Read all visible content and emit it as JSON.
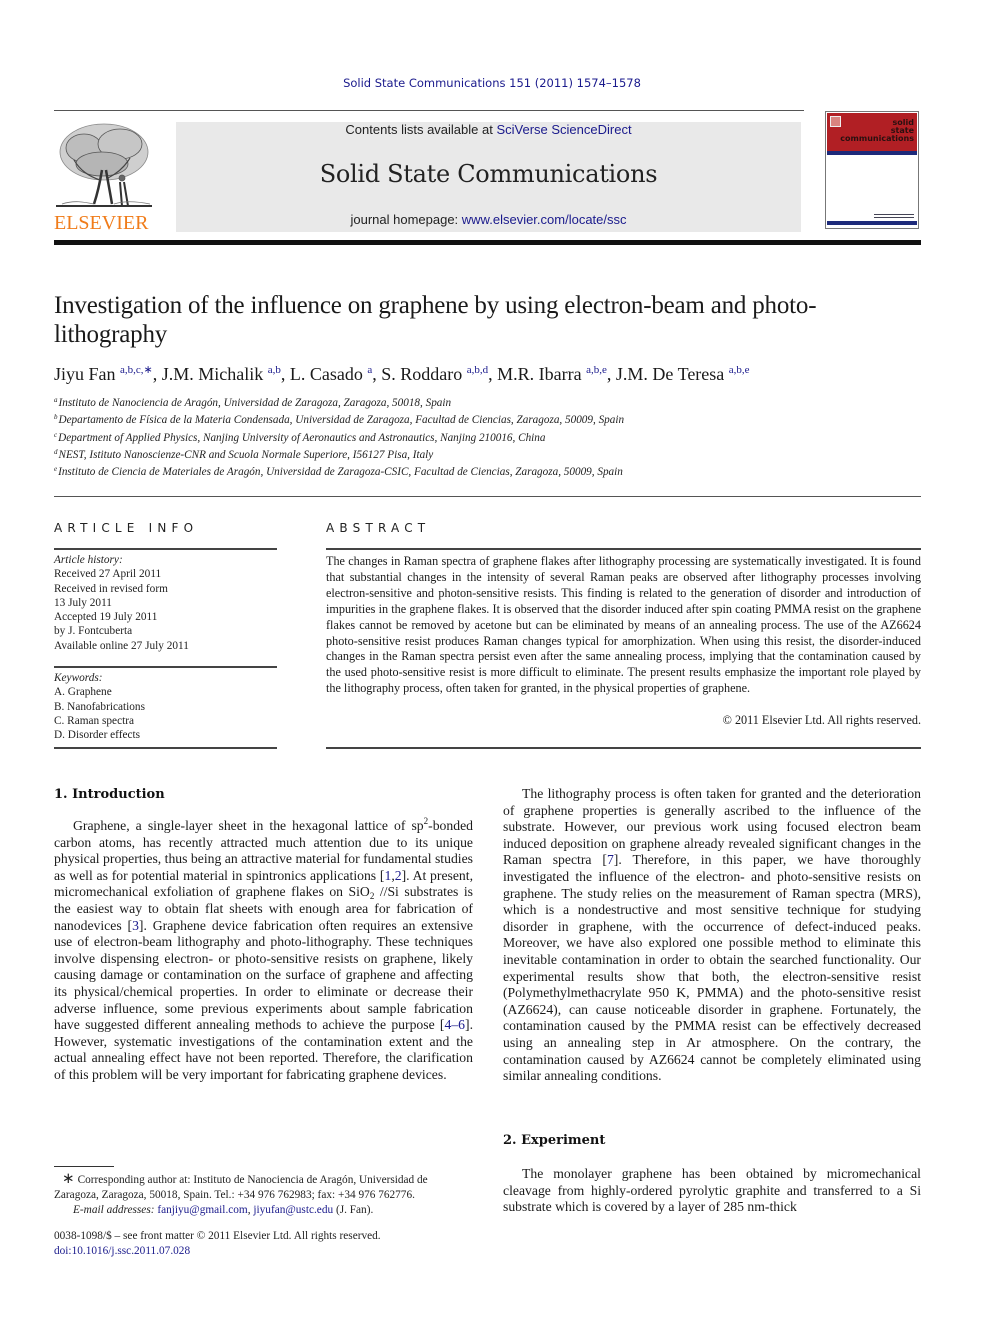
{
  "header": {
    "citation": "Solid State Communications 151 (2011) 1574–1578",
    "contents_prefix": "Contents lists available at ",
    "contents_link": "SciVerse ScienceDirect",
    "journal_name": "Solid State Communications",
    "homepage_prefix": "journal homepage: ",
    "homepage_link": "www.elsevier.com/locate/ssc",
    "publisher_logo_text": "ELSEVIER",
    "cover": {
      "title_lines": [
        "solid",
        "state",
        "communications"
      ],
      "red": "#b11f24",
      "blue": "#1d2a7a"
    }
  },
  "article": {
    "title": "Investigation of the influence on graphene by using electron-beam and photo-lithography",
    "authors": [
      {
        "name": "Jiyu Fan",
        "affil": "a,b,c,∗",
        "sep": ", "
      },
      {
        "name": "J.M. Michalik",
        "affil": "a,b",
        "sep": ", "
      },
      {
        "name": "L. Casado",
        "affil": "a",
        "sep": ", "
      },
      {
        "name": "S. Roddaro",
        "affil": "a,b,d",
        "sep": ", "
      },
      {
        "name": "M.R. Ibarra",
        "affil": "a,b,e",
        "sep": ", "
      },
      {
        "name": "J.M. De Teresa",
        "affil": "a,b,e",
        "sep": ""
      }
    ],
    "affiliations": [
      {
        "key": "a",
        "text": "Instituto de Nanociencia de Aragón, Universidad de Zaragoza, Zaragoza, 50018, Spain"
      },
      {
        "key": "b",
        "text": "Departamento de Física de la Materia Condensada, Universidad de Zaragoza, Facultad de Ciencias, Zaragoza, 50009, Spain"
      },
      {
        "key": "c",
        "text": "Department of Applied Physics, Nanjing University of Aeronautics and Astronautics, Nanjing 210016, China"
      },
      {
        "key": "d",
        "text": "NEST, Istituto Nanoscienze-CNR and Scuola Normale Superiore, I56127 Pisa, Italy"
      },
      {
        "key": "e",
        "text": "Instituto de Ciencia de Materiales de Aragón, Universidad de Zaragoza-CSIC, Facultad de Ciencias, Zaragoza, 50009, Spain"
      }
    ]
  },
  "article_info": {
    "heading": "ARTICLE INFO",
    "history_label": "Article history:",
    "history": [
      "Received 27 April 2011",
      "Received in revised form",
      "13 July 2011",
      "Accepted 19 July 2011",
      "by J. Fontcuberta",
      "Available online 27 July 2011"
    ],
    "keywords_label": "Keywords:",
    "keywords": [
      "A. Graphene",
      "B. Nanofabrications",
      "C. Raman spectra",
      "D. Disorder effects"
    ]
  },
  "abstract": {
    "heading": "ABSTRACT",
    "text": "The changes in Raman spectra of graphene flakes after lithography processing are systematically investigated. It is found that substantial changes in the intensity of several Raman peaks are observed after lithography processes involving electron-sensitive and photon-sensitive resists. This finding is related to the generation of disorder and introduction of impurities in the graphene flakes. It is observed that the disorder induced after spin coating PMMA resist on the graphene flakes cannot be removed by acetone but can be eliminated by means of an annealing process. The use of the AZ6624 photo-sensitive resist produces Raman changes typical for amorphization. When using this resist, the disorder-induced changes in the Raman spectra persist even after the same annealing process, implying that the contamination caused by the used photo-sensitive resist is more difficult to eliminate. The present results emphasize the important role played by the lithography process, often taken for granted, in the physical properties of graphene.",
    "copyright": "© 2011 Elsevier Ltd. All rights reserved."
  },
  "sections": {
    "intro": {
      "heading": "1.  Introduction",
      "p1_a": "Graphene, a single-layer sheet in the hexagonal lattice of sp",
      "p1_sup": "2",
      "p1_b": "-bonded carbon atoms, has recently attracted much attention due to its unique physical properties, thus being an attractive material for fundamental studies as well as for potential material in spintronics applications [",
      "ref_1": "1",
      "ref_comma": ",",
      "ref_2": "2",
      "p1_c": "]. At present, micromechanical exfoliation of graphene flakes on SiO",
      "p1_sub": "2",
      "p1_d": " //Si substrates is the easiest way to obtain flat sheets with enough area for fabrication of nanodevices [",
      "ref_3": "3",
      "p1_e": "]. Graphene device fabrication often requires an extensive use of electron-beam lithography and photo-lithography. These techniques involve dispensing electron- or photo-sensitive resists on graphene, likely causing damage or contamination on the surface of graphene and affecting its physical/chemical properties. In order to eliminate or decrease their adverse influence, some previous experiments about sample fabrication have suggested different annealing methods to achieve the purpose [",
      "ref_4_6": "4–6",
      "p1_f": "]. However, systematic investigations of the contamination extent and the actual annealing effect have not been reported. Therefore, the clarification of this problem will be very important for fabricating graphene devices."
    },
    "col2": {
      "p_a": "The lithography process is often taken for granted and the deterioration of graphene properties is generally ascribed to the influence of the substrate. However, our previous work using focused electron beam induced deposition on graphene already revealed significant changes in the Raman spectra [",
      "ref_7": "7",
      "p_b": "]. Therefore, in this paper, we have thoroughly investigated the influence of the electron- and photo-sensitive resists on graphene. The study relies on the measurement of Raman spectra (MRS), which is a nondestructive and most sensitive technique for studying disorder in graphene, with the occurrence of defect-induced peaks. Moreover, we have also explored one possible method to eliminate this inevitable contamination in order to obtain the searched functionality. Our experimental results show that both, the electron-sensitive resist (Polymethylmethacrylate 950 K, PMMA) and the photo-sensitive resist (AZ6624), can cause noticeable disorder in graphene. Fortunately, the contamination caused by the PMMA resist can be effectively decreased using an annealing step in Ar atmosphere. On the contrary, the contamination caused by AZ6624 cannot be completely eliminated using similar annealing conditions."
    },
    "experiment": {
      "heading": "2.  Experiment",
      "text": "The monolayer graphene has been obtained by micromechanical cleavage from highly-ordered pyrolytic graphite and transferred to a Si substrate which is covered by a layer of 285 nm-thick"
    }
  },
  "footnote": {
    "star": "∗",
    "corresponding": "Corresponding author at: Instituto de Nanociencia de Aragón, Universidad de Zaragoza, Zaragoza, 50018, Spain. Tel.: +34 976 762983; fax: +34 976 762776.",
    "email_label": "E-mail addresses:",
    "email_1": "fanjiyu@gmail.com",
    "email_sep": ", ",
    "email_2": "jiyufan@ustc.edu",
    "email_suffix": " (J. Fan).",
    "front_matter": "0038-1098/$ – see front matter © 2011 Elsevier Ltd. All rights reserved.",
    "doi": "doi:10.1016/j.ssc.2011.07.028"
  }
}
